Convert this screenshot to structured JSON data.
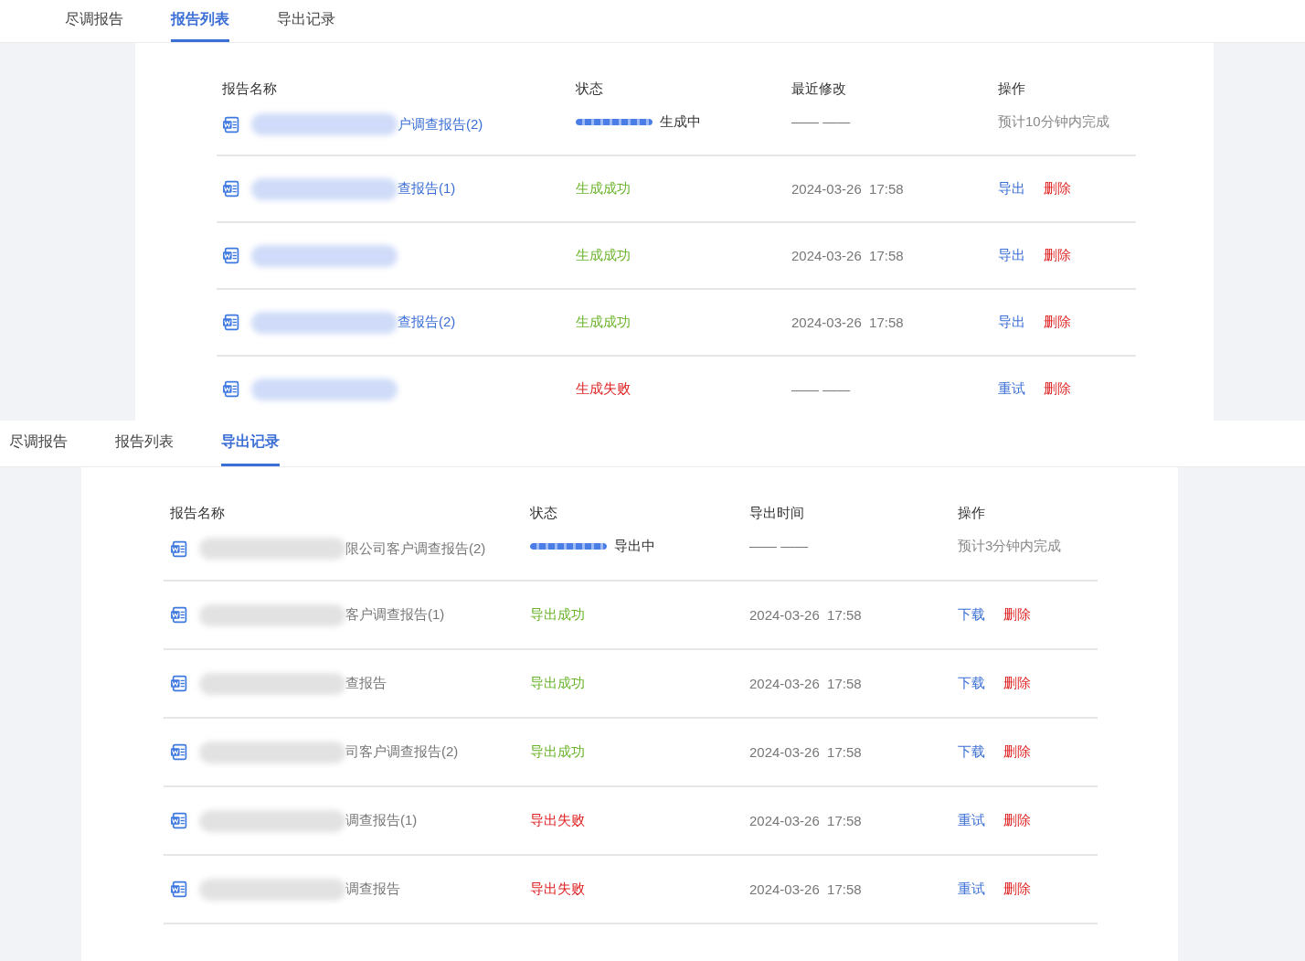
{
  "panels": [
    {
      "tabs": [
        {
          "label": "尽调报告",
          "selected": false
        },
        {
          "label": "报告列表",
          "selected": true
        },
        {
          "label": "导出记录",
          "selected": false
        }
      ],
      "names_as_links": true,
      "columns": [
        "报告名称",
        "状态",
        "最近修改",
        "操作"
      ],
      "rows": [
        {
          "name": "户调查报告(2)",
          "status": {
            "kind": "progress",
            "label": "生成中",
            "level": 1
          },
          "time": "—— ——",
          "actions": [
            {
              "kind": "note",
              "label": "预计10分钟内完成"
            }
          ]
        },
        {
          "name": "查报告(1)",
          "status": {
            "kind": "success",
            "label": "生成成功"
          },
          "time": "2024-03-26  17:58",
          "actions": [
            {
              "kind": "link",
              "label": "导出"
            },
            {
              "kind": "danger",
              "label": "删除"
            }
          ]
        },
        {
          "status": {
            "kind": "success",
            "label": "生成成功"
          },
          "time": "2024-03-26  17:58",
          "actions": [
            {
              "kind": "link",
              "label": "导出"
            },
            {
              "kind": "danger",
              "label": "删除"
            }
          ]
        },
        {
          "name": "查报告(2)",
          "status": {
            "kind": "success",
            "label": "生成成功"
          },
          "time": "2024-03-26  17:58",
          "actions": [
            {
              "kind": "link",
              "label": "导出"
            },
            {
              "kind": "danger",
              "label": "删除"
            }
          ]
        },
        {
          "status": {
            "kind": "fail",
            "label": "生成失败"
          },
          "time": "—— ——",
          "actions": [
            {
              "kind": "link",
              "label": "重试"
            },
            {
              "kind": "danger",
              "label": "删除"
            }
          ]
        }
      ]
    },
    {
      "tabs": [
        {
          "label": "尽调报告",
          "selected": false
        },
        {
          "label": "报告列表",
          "selected": false
        },
        {
          "label": "导出记录",
          "selected": true
        }
      ],
      "names_as_links": false,
      "columns": [
        "报告名称",
        "状态",
        "导出时间",
        "操作"
      ],
      "rows": [
        {
          "name": "限公司客户调查报告(2)",
          "status": {
            "kind": "progress",
            "label": "导出中",
            "level": 1
          },
          "time": "—— ——",
          "actions": [
            {
              "kind": "note",
              "label": "预计3分钟内完成"
            }
          ]
        },
        {
          "name": "客户调查报告(1)",
          "status": {
            "kind": "success",
            "label": "导出成功"
          },
          "time": "2024-03-26  17:58",
          "actions": [
            {
              "kind": "link",
              "label": "下载"
            },
            {
              "kind": "danger",
              "label": "删除"
            }
          ]
        },
        {
          "name": "查报告",
          "status": {
            "kind": "success",
            "label": "导出成功"
          },
          "time": "2024-03-26  17:58",
          "actions": [
            {
              "kind": "link",
              "label": "下载"
            },
            {
              "kind": "danger",
              "label": "删除"
            }
          ]
        },
        {
          "name": "司客户调查报告(2)",
          "status": {
            "kind": "success",
            "label": "导出成功"
          },
          "time": "2024-03-26  17:58",
          "actions": [
            {
              "kind": "link",
              "label": "下载"
            },
            {
              "kind": "danger",
              "label": "删除"
            }
          ]
        },
        {
          "name": "调查报告(1)",
          "status": {
            "kind": "fail",
            "label": "导出失败"
          },
          "time": "2024-03-26  17:58",
          "actions": [
            {
              "kind": "link",
              "label": "重试"
            },
            {
              "kind": "danger",
              "label": "删除"
            }
          ]
        },
        {
          "name": "调查报告",
          "status": {
            "kind": "fail",
            "label": "导出失败"
          },
          "time": "2024-03-26  17:58",
          "actions": [
            {
              "kind": "link",
              "label": "重试"
            },
            {
              "kind": "danger",
              "label": "删除"
            }
          ]
        }
      ]
    }
  ]
}
